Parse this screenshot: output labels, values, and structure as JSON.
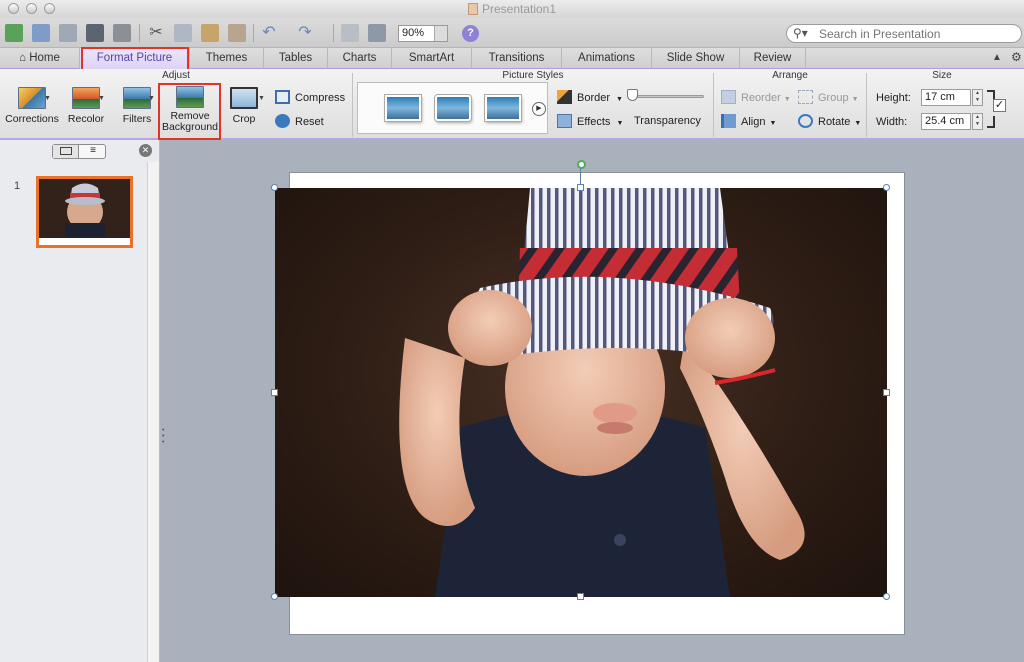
{
  "window": {
    "title": "Presentation1"
  },
  "toolbar": {
    "zoom": "90%",
    "help_label": "?",
    "search_placeholder": "Search in Presentation"
  },
  "tabs": [
    {
      "label": "Home"
    },
    {
      "label": "Format Picture"
    },
    {
      "label": "Themes"
    },
    {
      "label": "Tables"
    },
    {
      "label": "Charts"
    },
    {
      "label": "SmartArt"
    },
    {
      "label": "Transitions"
    },
    {
      "label": "Animations"
    },
    {
      "label": "Slide Show"
    },
    {
      "label": "Review"
    }
  ],
  "ribbon": {
    "adjust": {
      "title": "Adjust",
      "corrections": "Corrections",
      "recolor": "Recolor",
      "filters": "Filters",
      "remove_background_line1": "Remove",
      "remove_background_line2": "Background",
      "crop": "Crop",
      "compress": "Compress",
      "reset": "Reset"
    },
    "picture_styles": {
      "title": "Picture Styles",
      "border": "Border",
      "effects": "Effects",
      "transparency": "Transparency",
      "transparency_level": 0
    },
    "arrange": {
      "title": "Arrange",
      "reorder": "Reorder",
      "group": "Group",
      "align": "Align",
      "rotate": "Rotate"
    },
    "size": {
      "title": "Size",
      "height_label": "Height:",
      "height_value": "17 cm",
      "width_label": "Width:",
      "width_value": "25.4 cm",
      "lock_aspect_checked": "✓"
    }
  },
  "slides_panel": {
    "slide_number": "1"
  },
  "highlight_color": "#e0342b",
  "accent_color": "#b9a4e6"
}
